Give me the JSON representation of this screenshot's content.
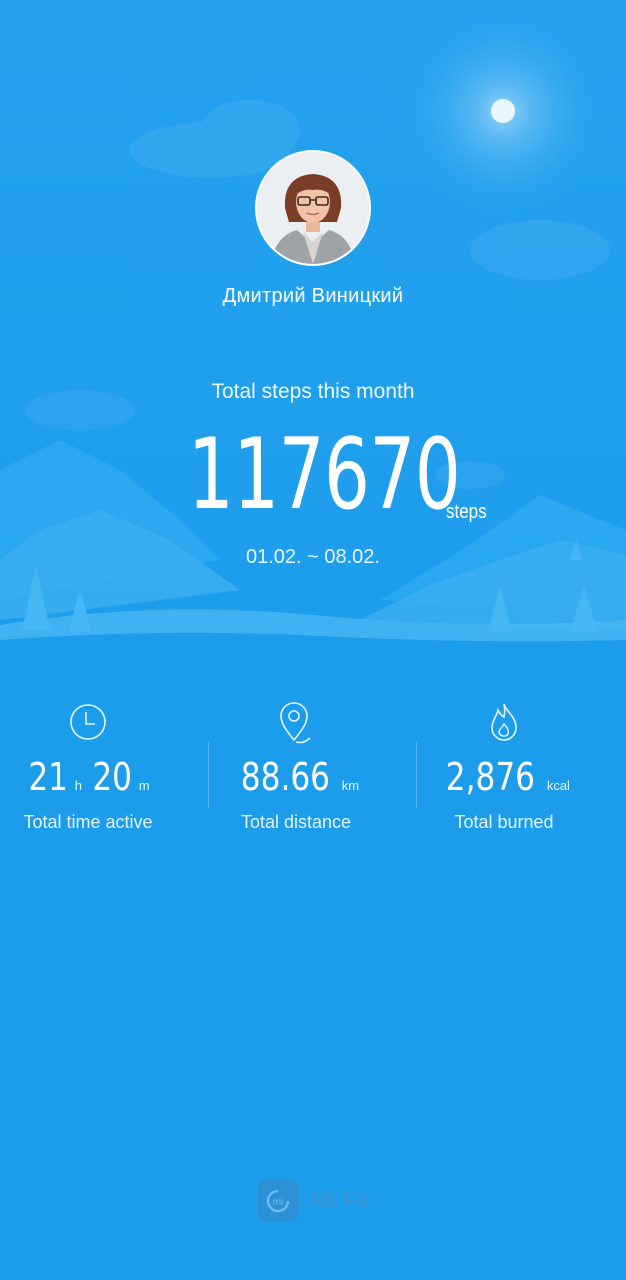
{
  "profile": {
    "name": "Дмитрий Виницкий",
    "avatar_icon": "user-photo"
  },
  "steps": {
    "caption": "Total steps this month",
    "value": "117670",
    "unit": "steps",
    "date_range": "01.02. ~ 08.02."
  },
  "stats": {
    "time_active": {
      "icon": "clock-icon",
      "hours": "21",
      "hours_unit": "h",
      "minutes": "20",
      "minutes_unit": "m",
      "label": "Total time active"
    },
    "distance": {
      "icon": "location-pin-icon",
      "value": "88.66",
      "unit": "km",
      "label": "Total distance"
    },
    "calories": {
      "icon": "flame-icon",
      "value": "2,876",
      "unit": "kcal",
      "label": "Total burned"
    }
  },
  "brand": {
    "name": "Mi Fit",
    "logo_text": "mi"
  },
  "colors": {
    "background": "#1c9deb",
    "sky_top": "#2aa4ee",
    "hills": "#3fb0f0"
  }
}
